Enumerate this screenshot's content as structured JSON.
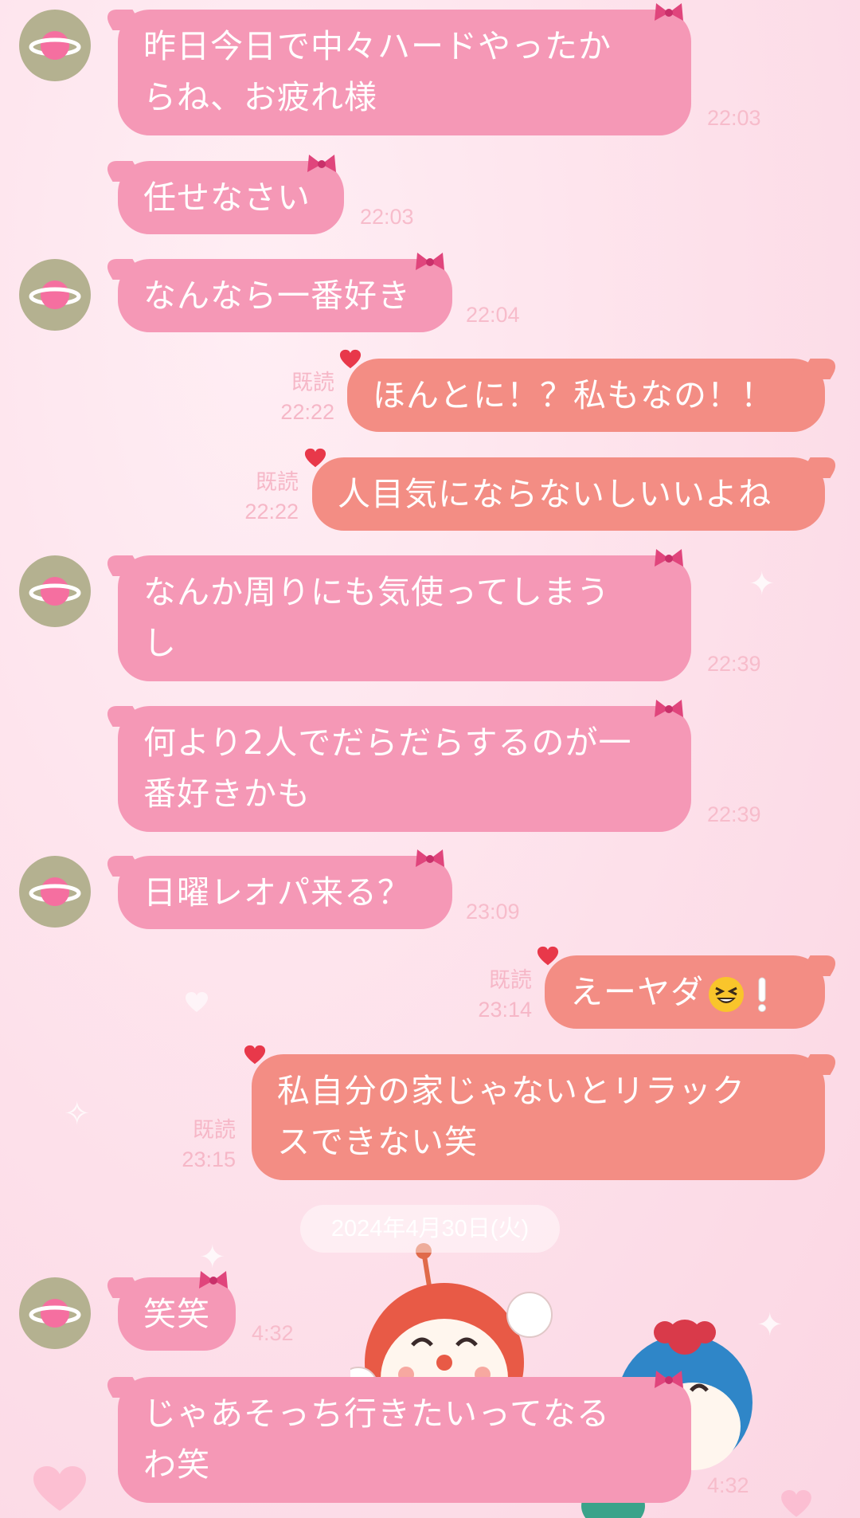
{
  "colors": {
    "background": "#fde0ea",
    "incoming_bubble": "#f598b6",
    "outgoing_bubble": "#f38d84",
    "timestamp": "#f7bccb",
    "avatar": "#b4b190"
  },
  "icons": {
    "incoming_decoration": "pink-bow-icon",
    "outgoing_decoration": "red-heart-icon",
    "avatar": "planet-icon",
    "emoji": "grinning-squinting-face-emoji"
  },
  "messages": [
    {
      "side": "in",
      "text_lines": [
        "昨日今日で中々ハードやったか",
        "らね、お疲れ様"
      ],
      "time": "22:03"
    },
    {
      "side": "in",
      "text_lines": [
        "任せなさい"
      ],
      "time": "22:03"
    },
    {
      "side": "in",
      "text_lines": [
        "なんなら一番好き"
      ],
      "time": "22:04"
    },
    {
      "side": "out",
      "text_lines": [
        "ほんとに！？私もなの！！"
      ],
      "read": "既読",
      "time": "22:22"
    },
    {
      "side": "out",
      "text_lines": [
        "人目気にならないしいいよね"
      ],
      "read": "既読",
      "time": "22:22"
    },
    {
      "side": "in",
      "text_lines": [
        "なんか周りにも気使ってしまう",
        "し"
      ],
      "time": "22:39"
    },
    {
      "side": "in",
      "text_lines": [
        "何より2人でだらだらするのが一",
        "番好きかも"
      ],
      "time": "22:39"
    },
    {
      "side": "in",
      "text_lines": [
        "日曜レオパ来る？"
      ],
      "time": "23:09"
    },
    {
      "side": "out",
      "text_prefix": "えーヤダ",
      "read": "既読",
      "time": "23:14"
    },
    {
      "side": "out",
      "text_lines": [
        "私自分の家じゃないとリラック",
        "スできない笑"
      ],
      "read": "既読",
      "time": "23:15"
    },
    {
      "side": "in",
      "text_lines": [
        "笑笑"
      ],
      "time": "4:32"
    },
    {
      "side": "in",
      "text_lines": [
        "じゃあそっち行きたいってなる",
        "わ笑"
      ],
      "time": "4:32"
    }
  ],
  "date_separator": "2024年4月30日(火)"
}
